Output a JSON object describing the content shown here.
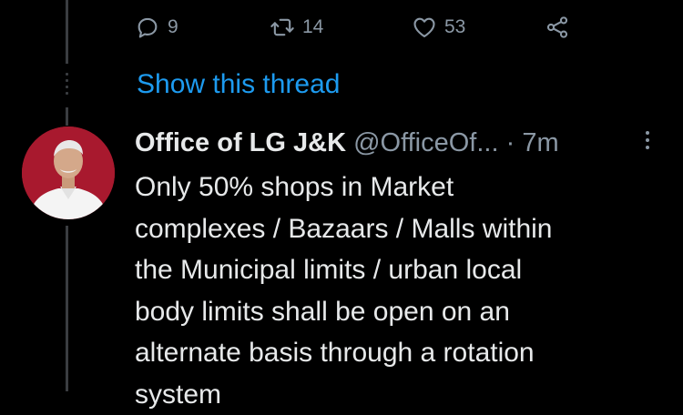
{
  "actions": {
    "reply_count": "9",
    "retweet_count": "14",
    "like_count": "53"
  },
  "thread": {
    "show_label": "Show this thread"
  },
  "tweet": {
    "author_name": "Office of LG J&K",
    "handle": "@OfficeOf...",
    "separator": " · ",
    "time": "7m",
    "body_lines": [
      "Only 50% shops in Market",
      "complexes / Bazaars / Malls within",
      "the Municipal limits / urban local",
      "body limits shall be open on an",
      "alternate basis through a rotation",
      "system"
    ]
  },
  "colors": {
    "background": "#000000",
    "link": "#1d9bf0",
    "muted": "#8b98a5",
    "text": "#e7e9ea",
    "avatar_bg": "#a8192e"
  },
  "icons": [
    "reply-icon",
    "retweet-icon",
    "like-icon",
    "share-icon",
    "more-options-icon"
  ]
}
